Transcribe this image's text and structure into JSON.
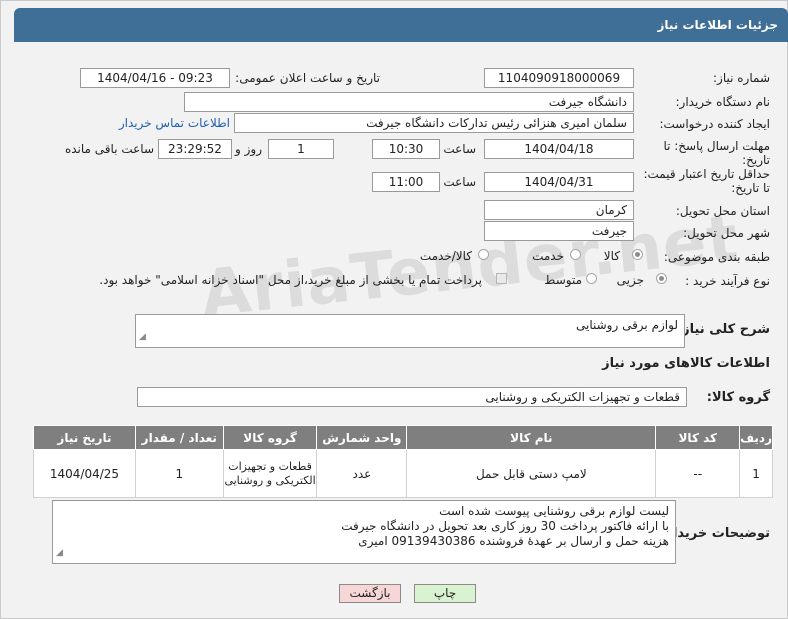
{
  "header": {
    "title": "جزئیات اطلاعات نیاز"
  },
  "fields": {
    "need_number_label": "شماره نیاز:",
    "need_number": "1104090918000069",
    "announce_label": "تاریخ و ساعت اعلان عمومی:",
    "announce_value": "1404/04/16 - 09:23",
    "buyer_org_label": "نام دستگاه خریدار:",
    "buyer_org": "دانشگاه جیرفت",
    "creator_label": "ایجاد کننده درخواست:",
    "creator": "سلمان امیری هنزائی رئیس تدارکات دانشگاه جیرفت",
    "contact_link": "اطلاعات تماس خریدار",
    "deadline_label_1": "مهلت ارسال پاسخ: تا",
    "deadline_label_2": "تاریخ:",
    "deadline_date": "1404/04/18",
    "time_label": "ساعت",
    "deadline_time": "10:30",
    "days_value": "1",
    "days_label": "روز و",
    "remaining_time": "23:29:52",
    "remaining_label": "ساعت باقی مانده",
    "validity_label_1": "حداقل تاریخ اعتبار قیمت:",
    "validity_label_2": "تا تاریخ:",
    "validity_date": "1404/04/31",
    "validity_time_label": "ساعت",
    "validity_time": "11:00",
    "province_label": "استان محل تحویل:",
    "province": "کرمان",
    "city_label": "شهر محل تحویل:",
    "city": "جیرفت",
    "category_label": "طبقه بندی موضوعی:",
    "category_options": [
      "کالا",
      "خدمت",
      "کالا/خدمت"
    ],
    "purchase_type_label": "نوع فرآیند خرید :",
    "purchase_options": [
      "جزیی",
      "متوسط"
    ],
    "payment_note": "پرداخت تمام یا بخشی از مبلغ خرید،از محل \"اسناد خزانه اسلامی\" خواهد بود.",
    "description_label": "شرح کلی نیاز:",
    "description": "لوازم برقی روشنایی",
    "goods_info_title": "اطلاعات کالاهای مورد نیاز",
    "goods_group_label": "گروه کالا:",
    "goods_group": "قطعات و تجهیزات الکتریکی و روشنایی"
  },
  "table": {
    "headers": [
      "ردیف",
      "کد کالا",
      "نام کالا",
      "واحد شمارش",
      "گروه کالا",
      "تعداد / مقدار",
      "تاریخ نیاز"
    ],
    "rows": [
      [
        "1",
        "--",
        "لامپ دستی قابل حمل",
        "عدد",
        "قطعات و تجهیزات الکتریکی و روشنایی",
        "1",
        "1404/04/25"
      ]
    ]
  },
  "buyer_notes": {
    "label": "توضیحات خریدار:",
    "lines": [
      "لیست لوازم برقی روشنایی پیوست شده است",
      "با ارائه فاکتور پرداخت 30 روز کاری بعد تحویل در دانشگاه جیرفت",
      "هزینه حمل و ارسال بر عهدهٔ فروشنده 09139430386 امیری"
    ]
  },
  "buttons": {
    "print": "چاپ",
    "back": "بازگشت"
  },
  "watermark": "AriaTender.net",
  "colors": {
    "header": "#3f6f96",
    "print_button": "#d9f2d0",
    "back_button": "#f6d6d6",
    "link": "#1f5fb3"
  }
}
